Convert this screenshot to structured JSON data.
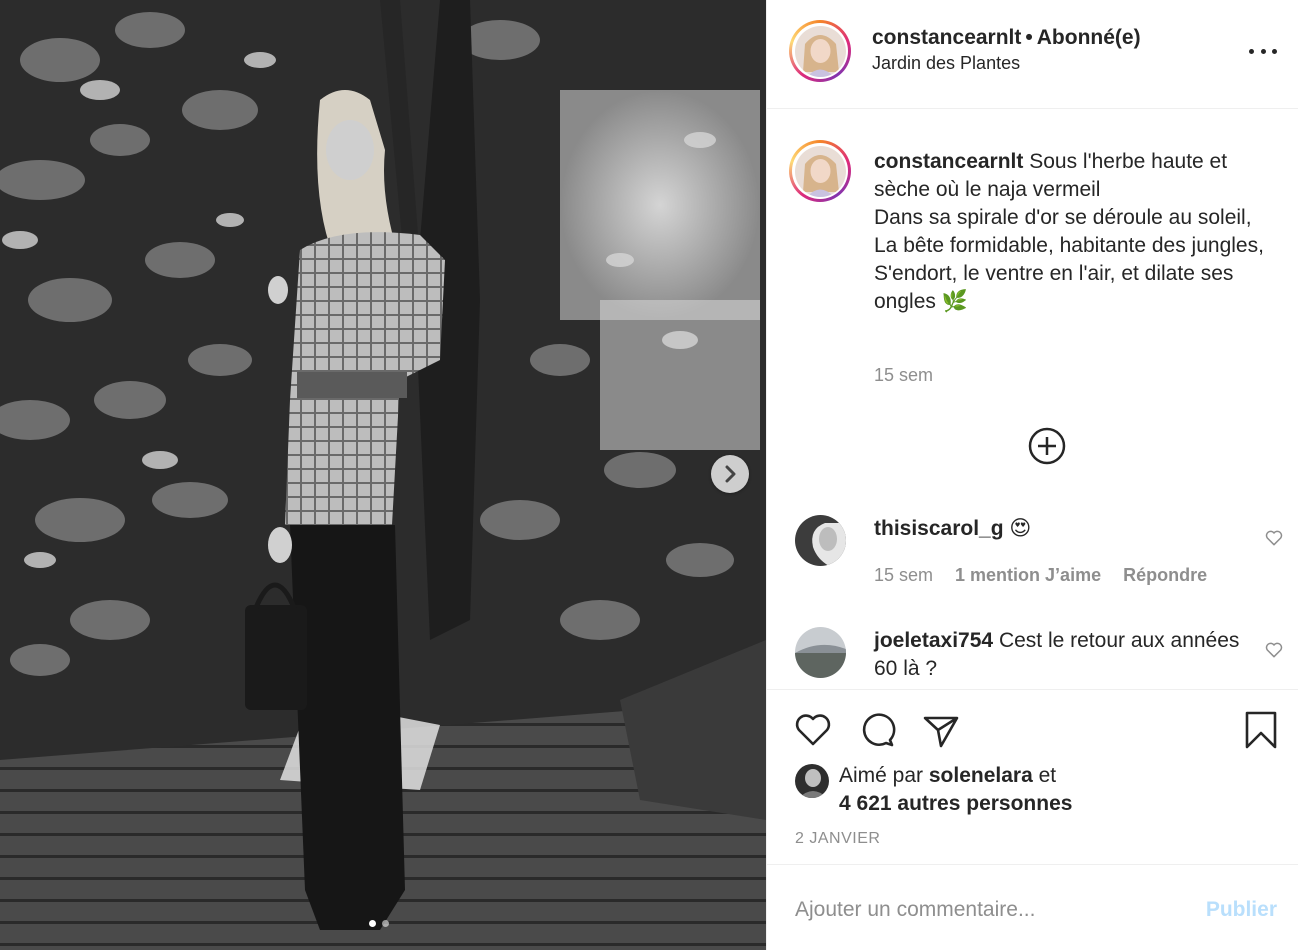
{
  "post": {
    "username": "constancearnlt",
    "separator": "•",
    "follow_status": "Abonné(e)",
    "location": "Jardin des Plantes",
    "image_slides": 2,
    "active_slide": 1
  },
  "caption": {
    "username": "constancearnlt",
    "text": "Sous l'herbe haute et sèche où le naja vermeil\nDans sa spirale d'or se déroule au soleil,\nLa bête formidable, habitante des jungles,\nS'endort, le ventre en l'air, et dilate ses ongles 🌿",
    "time": "15 sem"
  },
  "comments": [
    {
      "username": "thisiscarol_g",
      "text": "😍",
      "time": "15 sem",
      "likes_label": "1 mention J’aime",
      "reply_label": "Répondre"
    },
    {
      "username": "joeletaxi754",
      "text": "Cest le retour aux années 60 là ?"
    }
  ],
  "likes": {
    "prefix": "Aimé par",
    "liker": "solenelara",
    "conjunction": "et",
    "others": "4 621 autres personnes"
  },
  "date": "2 JANVIER",
  "add_comment": {
    "placeholder": "Ajouter un commentaire...",
    "publish_label": "Publier"
  },
  "icons": {
    "more": "more-options-icon",
    "next": "chevron-right-icon",
    "load_more": "plus-circle-icon",
    "like": "heart-icon",
    "comment": "comment-icon",
    "share": "paper-plane-icon",
    "save": "bookmark-icon"
  },
  "colors": {
    "text": "#262626",
    "secondary": "#8e8e8e",
    "border": "#efefef",
    "publish_disabled": "#b9dffc"
  }
}
